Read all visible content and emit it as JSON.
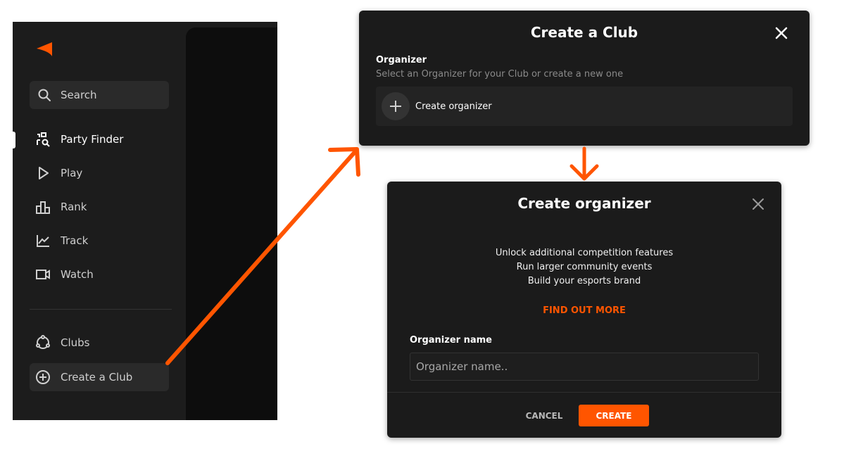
{
  "sidebar": {
    "search_label": "Search",
    "nav": [
      {
        "label": "Party Finder",
        "icon": "party-finder-icon"
      },
      {
        "label": "Play",
        "icon": "play-icon"
      },
      {
        "label": "Rank",
        "icon": "rank-icon"
      },
      {
        "label": "Track",
        "icon": "track-icon"
      },
      {
        "label": "Watch",
        "icon": "watch-icon"
      }
    ],
    "bottom": [
      {
        "label": "Clubs",
        "icon": "clubs-icon"
      },
      {
        "label": "Create a Club",
        "icon": "plus-circle-icon"
      }
    ]
  },
  "create_club_modal": {
    "title": "Create a Club",
    "organizer_label": "Organizer",
    "organizer_sub": "Select an Organizer for your Club or create a new one",
    "create_organizer_label": "Create organizer"
  },
  "create_organizer_modal": {
    "title": "Create organizer",
    "features": [
      "Unlock additional competition features",
      "Run larger community events",
      "Build your esports brand"
    ],
    "find_out_more": "FIND OUT MORE",
    "name_label": "Organizer name",
    "name_placeholder": "Organizer name..",
    "cancel_label": "CANCEL",
    "create_label": "CREATE"
  },
  "colors": {
    "accent": "#ff5500",
    "modal_bg": "#1b1b1b",
    "sidebar_bg": "#1c1c1c"
  }
}
